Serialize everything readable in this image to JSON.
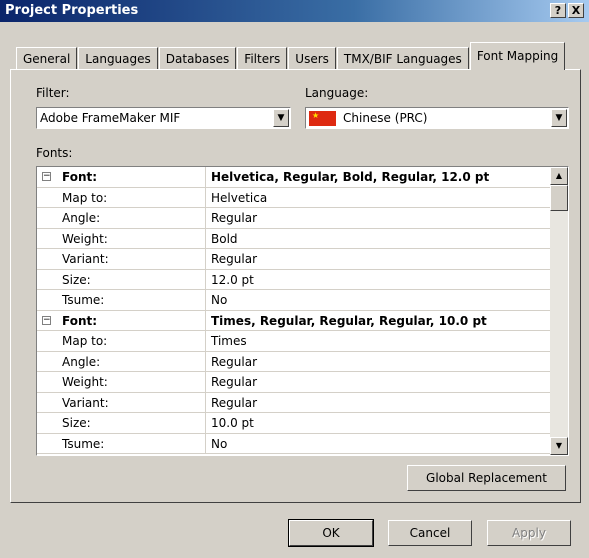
{
  "window": {
    "title": "Project Properties"
  },
  "titlebar_buttons": {
    "help": "?",
    "close": "X"
  },
  "tabs": [
    {
      "label": "General"
    },
    {
      "label": "Languages"
    },
    {
      "label": "Databases"
    },
    {
      "label": "Filters"
    },
    {
      "label": "Users"
    },
    {
      "label": "TMX/BIF Languages"
    },
    {
      "label": "Font Mapping",
      "active": true
    }
  ],
  "filter": {
    "label": "Filter:",
    "value": "Adobe FrameMaker MIF"
  },
  "language": {
    "label": "Language:",
    "value": "Chinese (PRC)",
    "flag_color": "#de2910"
  },
  "fonts": {
    "label": "Fonts:",
    "rows": [
      {
        "key": "Font:",
        "value": "Helvetica, Regular, Bold, Regular, 12.0 pt",
        "header": true
      },
      {
        "key": "Map to:",
        "value": "Helvetica"
      },
      {
        "key": "Angle:",
        "value": "Regular"
      },
      {
        "key": "Weight:",
        "value": "Bold"
      },
      {
        "key": "Variant:",
        "value": "Regular"
      },
      {
        "key": "Size:",
        "value": "12.0 pt"
      },
      {
        "key": "Tsume:",
        "value": "No"
      },
      {
        "key": "Font:",
        "value": "Times, Regular, Regular, Regular, 10.0 pt",
        "header": true
      },
      {
        "key": "Map to:",
        "value": "Times"
      },
      {
        "key": "Angle:",
        "value": "Regular"
      },
      {
        "key": "Weight:",
        "value": "Regular"
      },
      {
        "key": "Variant:",
        "value": "Regular"
      },
      {
        "key": "Size:",
        "value": "10.0 pt"
      },
      {
        "key": "Tsume:",
        "value": "No"
      }
    ]
  },
  "buttons": {
    "global_replacement": "Global Replacement",
    "ok": "OK",
    "cancel": "Cancel",
    "apply": "Apply"
  },
  "colors": {
    "titlebar": "#0a246a",
    "face": "#d4d0c8"
  }
}
